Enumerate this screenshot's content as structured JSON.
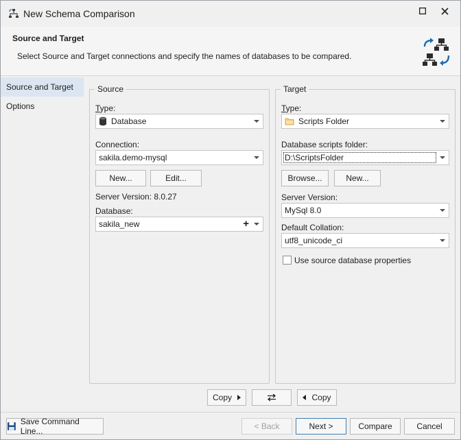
{
  "window": {
    "title": "New Schema Comparison"
  },
  "header": {
    "title": "Source and Target",
    "description": "Select Source and Target connections and specify the names of databases to be compared."
  },
  "sidebar": {
    "items": [
      {
        "label": "Source and Target",
        "active": true
      },
      {
        "label": "Options",
        "active": false
      }
    ]
  },
  "source": {
    "group_title": "Source",
    "type_label": "Type:",
    "type_value": "Database",
    "connection_label": "Connection:",
    "connection_value": "sakila.demo-mysql",
    "new_button": "New...",
    "edit_button": "Edit...",
    "server_version_text": "Server Version: 8.0.27",
    "database_label": "Database:",
    "database_value": "sakila_new"
  },
  "target": {
    "group_title": "Target",
    "type_label": "Type:",
    "type_value": "Scripts Folder",
    "folder_label": "Database scripts folder:",
    "folder_value": "D:\\ScriptsFolder",
    "browse_button": "Browse...",
    "new_button": "New...",
    "server_version_label": "Server Version:",
    "server_version_value": "MySql 8.0",
    "collation_label": "Default Collation:",
    "collation_value": "utf8_unicode_ci",
    "use_source_label": "Use source database properties",
    "use_source_checked": false
  },
  "copy_bar": {
    "copy_right": "Copy",
    "copy_left": "Copy"
  },
  "footer": {
    "save_command_line": "Save Command Line...",
    "back": "< Back",
    "next": "Next >",
    "compare": "Compare",
    "cancel": "Cancel"
  },
  "colors": {
    "accent": "#1e6ab4",
    "sidebar_active": "#dce6f2",
    "folder": "#e8b04a"
  }
}
